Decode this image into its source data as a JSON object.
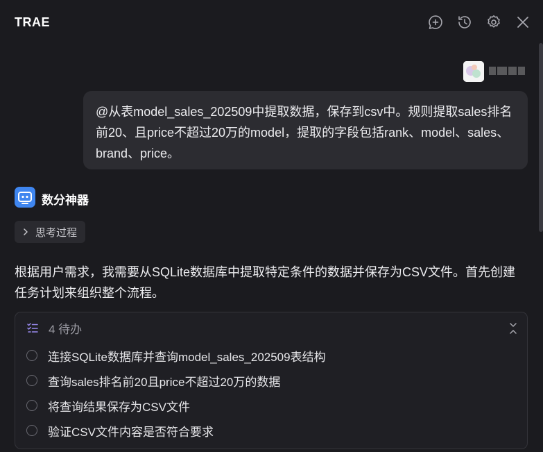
{
  "header": {
    "title": "TRAE",
    "icons": [
      "new-chat-icon",
      "history-icon",
      "settings-icon",
      "close-icon"
    ]
  },
  "user_message": {
    "text": "@从表model_sales_202509中提取数据，保存到csv中。规则提取sales排名前20、且price不超过20万的model，提取的字段包括rank、model、sales、brand、price。"
  },
  "assistant": {
    "name": "数分神器",
    "thinking_label": "思考过程",
    "reply": "根据用户需求，我需要从SQLite数据库中提取特定条件的数据并保存为CSV文件。首先创建任务计划来组织整个流程。"
  },
  "todo": {
    "count_label": "4 待办",
    "items": [
      {
        "label": "连接SQLite数据库并查询model_sales_202509表结构"
      },
      {
        "label": "查询sales排名前20且price不超过20万的数据"
      },
      {
        "label": "将查询结果保存为CSV文件"
      },
      {
        "label": "验证CSV文件内容是否符合要求"
      }
    ]
  },
  "colors": {
    "background": "#1b1b1f",
    "bubble": "#2c2c31",
    "accent_purple": "#9b8cf2",
    "bot_avatar": "#3f86f0"
  }
}
